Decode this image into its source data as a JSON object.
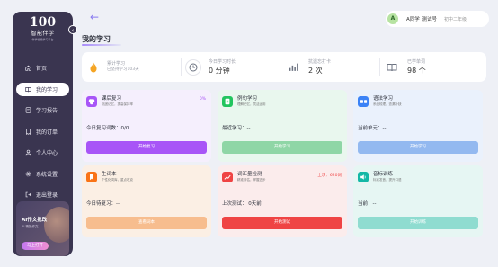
{
  "sidebar": {
    "logo_mark": "100",
    "logo_name": "智能伴学",
    "logo_sub": "— 伴学智能学习平台 —",
    "collapse_glyph": "‹",
    "items": [
      {
        "label": "首页",
        "icon": "home-icon"
      },
      {
        "label": "我的学习",
        "icon": "book-icon",
        "active": true
      },
      {
        "label": "学习报告",
        "icon": "report-icon"
      },
      {
        "label": "我的订单",
        "icon": "order-icon"
      },
      {
        "label": "个人中心",
        "icon": "user-icon"
      },
      {
        "label": "系统设置",
        "icon": "gear-icon"
      },
      {
        "label": "退出登录",
        "icon": "logout-icon"
      }
    ],
    "promo": {
      "title": "AI作文批改",
      "subtitle": "AI 精批作文",
      "button": "马上打开"
    }
  },
  "header": {
    "back_glyph": "←",
    "user": {
      "avatar_letter": "A",
      "name": "A同学_测试号",
      "grade": "初中二年级"
    }
  },
  "page_title": "我的学习",
  "stats": [
    {
      "label": "累计学习",
      "value": "",
      "sub": "已坚持学习103天",
      "icon": "flame-icon",
      "color": "#f5a524"
    },
    {
      "label": "今日学习时长",
      "value": "0 分钟",
      "sub": "",
      "icon": "clock-icon",
      "color": "#6b7280"
    },
    {
      "label": "抗遗忘打卡",
      "value": "2 次",
      "sub": "",
      "icon": "bar-chart-icon",
      "color": "#6b7280"
    },
    {
      "label": "已学单词",
      "value": "98 个",
      "sub": "",
      "icon": "open-book-icon",
      "color": "#6b7280"
    }
  ],
  "cards": [
    {
      "title": "课后复习",
      "desc": "巩固记忆，提高保持率",
      "badge": "0%",
      "stat": "今日复习词数：0/0",
      "button": "开始复习",
      "icon": "brain-icon",
      "accent": "#a855f7",
      "bg": "#f5effd",
      "btn": "#a855f7",
      "badge_color": "#a855f7"
    },
    {
      "title": "例句学习",
      "desc": "理解记忆，灵活运用",
      "badge": "",
      "stat": "最近学习：--",
      "button": "开始学习",
      "icon": "note-icon",
      "accent": "#22c55e",
      "bg": "#e9f7ee",
      "btn": "#8fd6a6",
      "badge_color": "#22c55e"
    },
    {
      "title": "语法学习",
      "desc": "系统梳理，查漏补缺",
      "badge": "",
      "stat": "当前单元：--",
      "button": "开始学习",
      "icon": "glasses-icon",
      "accent": "#3b82f6",
      "bg": "#eaf1fc",
      "btn": "#93b9f0",
      "badge_color": "#3b82f6"
    },
    {
      "title": "生词本",
      "desc": "个性化词库，重点攻克",
      "badge": "",
      "stat": "今日待复习：--",
      "button": "查看词本",
      "icon": "bookmark-icon",
      "accent": "#f97316",
      "bg": "#fbefe4",
      "btn": "#f7bd8e",
      "badge_color": "#f97316"
    },
    {
      "title": "词汇量检测",
      "desc": "精准评估，掌握进步",
      "badge": "上次：620词",
      "stat": "上次测试： 0天前",
      "button": "开始测试",
      "icon": "trend-icon",
      "accent": "#ef4444",
      "bg": "#fbecec",
      "btn": "#ef4444",
      "badge_color": "#ef4444"
    },
    {
      "title": "音标训练",
      "desc": "标准发音，提升口语",
      "badge": "",
      "stat": "当前：--",
      "button": "开始训练",
      "icon": "speaker-icon",
      "accent": "#14b8a6",
      "bg": "#e6f6f3",
      "btn": "#8fdcd0",
      "badge_color": "#14b8a6"
    }
  ]
}
